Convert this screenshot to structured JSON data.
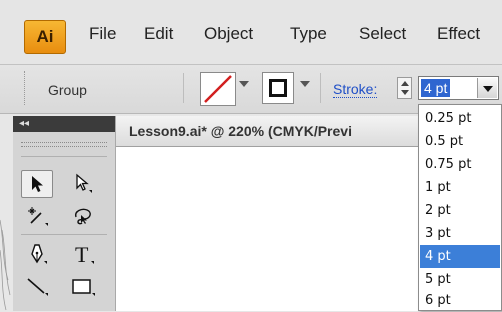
{
  "menubar": {
    "logo": "Ai",
    "items": [
      "File",
      "Edit",
      "Object",
      "Type",
      "Select",
      "Effect"
    ]
  },
  "control_bar": {
    "selection_label": "Group",
    "stroke_label": "Stroke:",
    "stroke_value": "4 pt",
    "fill_swatch_icon": "none-fill-swatch-icon",
    "stroke_swatch_icon": "stroke-swatch-icon"
  },
  "tools_panel": {
    "collapse_glyph": "◂◂",
    "tools": [
      "selection-tool",
      "direct-selection-tool",
      "magic-wand-tool",
      "lasso-tool",
      "pen-tool",
      "type-tool",
      "line-segment-tool",
      "rectangle-tool"
    ]
  },
  "document": {
    "tab_title": "Lesson9.ai* @ 220% (CMYK/Previ"
  },
  "stroke_dropdown": {
    "options": [
      "0.25 pt",
      "0.5 pt",
      "0.75 pt",
      "1 pt",
      "2 pt",
      "3 pt",
      "4 pt",
      "5 pt",
      "6 pt"
    ],
    "selected": "4 pt"
  },
  "colors": {
    "accent_blue": "#3c7fd8",
    "stroke_label_blue": "#1f4fc7",
    "ai_logo_orange": "#f0a020"
  }
}
